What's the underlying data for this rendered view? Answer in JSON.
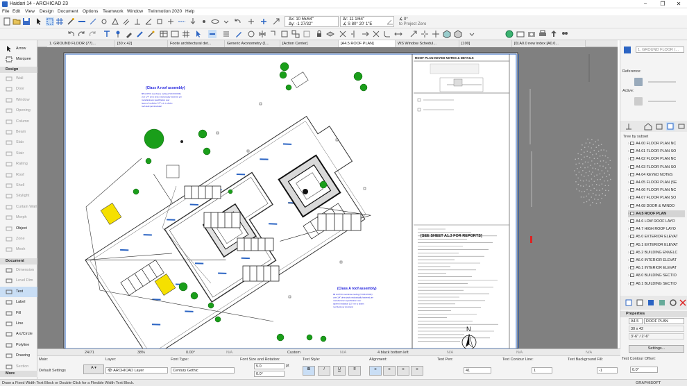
{
  "window": {
    "title": "Haidari 14 - ARCHICAD 23"
  },
  "menu": [
    "File",
    "Edit",
    "View",
    "Design",
    "Document",
    "Options",
    "Teamwork",
    "Window",
    "Twinmotion 2020",
    "Help"
  ],
  "coords": {
    "dx": "Δx: 10 55/64\"",
    "dy": "Δy: -1 27/32\"",
    "dr": "Δr: 11 1/64\"",
    "da": "∡ S 80° 20' 1\"E",
    "angle": "∡ 0°",
    "project_zero": "to Project Zero"
  },
  "tabs": [
    "1. GROUND FLOOR (77)...",
    "[30 x 42]",
    "Foote architectural det...",
    "Generic Axonometry (1...",
    "[Action Center]",
    "[A4.5 ROOF PLAN]",
    "WS Window Schedul...",
    "[100]",
    "[0] A0.0 new index [A0.0..."
  ],
  "active_tab_index": 5,
  "toolbox": {
    "arrow": "Arrow",
    "marquee": "Marquee",
    "design_title": "Design",
    "design": [
      "Wall",
      "Door",
      "Window",
      "Opening",
      "Column",
      "Beam",
      "Slab",
      "Stair",
      "Railing",
      "Roof",
      "Shell",
      "Skylight",
      "Curtain Wall",
      "Morph",
      "Object",
      "Zone",
      "Mesh"
    ],
    "document_title": "Document",
    "document": [
      "Dimension",
      "Level Dim",
      "Text",
      "Label",
      "Fill",
      "Line",
      "Arc/Circle",
      "Polyline",
      "Drawing",
      "Section"
    ],
    "more": "More"
  },
  "drawing": {
    "sheet_title": "ROOF PLAN KEYED NOTES & DETAILS",
    "note_title": "(Class A roof assembly)",
    "note_lines": [
      "88 mil PVC membrane roofing (TUCK ROOF)",
      "over 1/4\" dens deck mechanically fastened per",
      "manufacturers specification over",
      "tapered insulation 1/2\" min to drains",
      "roof deck per structural"
    ],
    "sheet_ref": "[SEE SHEET A1.3 FOR REPORTS]",
    "north": "N"
  },
  "navigator": {
    "layout_field": "1. GROUND FLOOR (...",
    "reference_label": "Reference:",
    "active_label": "Active:",
    "tree_label": "Tree by subset",
    "items": [
      "A4.00 FLOOR PLAN NC",
      "A4.01 FLOOR PLAN SO",
      "A4.02 FLOOR PLAN NC",
      "A4.03 FLOOR PLAN SO",
      "A4.04 KEYED NOTES",
      "A4.05 FLOOR PLAN (SE",
      "A4.06 FLOOR PLAN NC",
      "A4.07 FLOOR PLAN SO",
      "A4.08 DOOR & WINDO",
      "A4.5 ROOF PLAN",
      "A4.6 LOW ROOF LAYO",
      "A4.7 HIGH ROOF LAYO",
      "A5.0 EXTERIOR ELEVAT",
      "A5.1 EXTERIOR ELEVAT",
      "A5.2 BUILDING ENVELC",
      "A6.0 INTERIOR ELEVAT",
      "A6.1 INTERIOR ELEVAT",
      "A8.0 BUILDING SECTIO",
      "A8.1 BUILDING SECTIO"
    ],
    "selected_index": 9,
    "properties_title": "Properties",
    "prop_id": "A4.5",
    "prop_name": "ROOF PLAN",
    "prop_size": "30 x 42",
    "prop_scale": "3'-6\" / 2'-6\"",
    "settings": "Settings..."
  },
  "bottombar": {
    "page": "24/71",
    "zoom": "38%",
    "angle": "0.00°",
    "na1": "N/A",
    "scale": "Custom",
    "na2": "N/A",
    "pen_set": "4 black bottom left",
    "na3": "N/A",
    "na4": "N/A",
    "na5": "N/A"
  },
  "infobox": {
    "main_label": "Main:",
    "default_settings": "Default Settings",
    "layer_label": "Layer:",
    "layer_value": "ARCHICAD Layer",
    "font_type_label": "Font Type:",
    "font_value": "Century Gothic",
    "font_size_label": "Font Size and Rotation:",
    "font_size": "5.0",
    "font_unit": "pt",
    "rotation": "0.0°",
    "text_style_label": "Text Style:",
    "alignment_label": "Alignment:",
    "text_pen_label": "Text Pen:",
    "text_pen_value": "41",
    "contour_label": "Text Contour Line:",
    "contour_value": "1",
    "bg_fill_label": "Text Background Fill:",
    "bg_fill_value": "-1",
    "offset_label": "Text Contour Offset:",
    "offset_value": "0.0\""
  },
  "status": {
    "message": "Draw a Fixed Width Text Block or Double-Click for a Flexible Width Text Block.",
    "brand": "GRAPHISOFT"
  },
  "colors": {
    "accent": "#2b64c3",
    "selection": "#c9def5",
    "note_blue": "#1a1adc",
    "tree_green": "#1a9e1a",
    "yellow": "#f5e000"
  }
}
